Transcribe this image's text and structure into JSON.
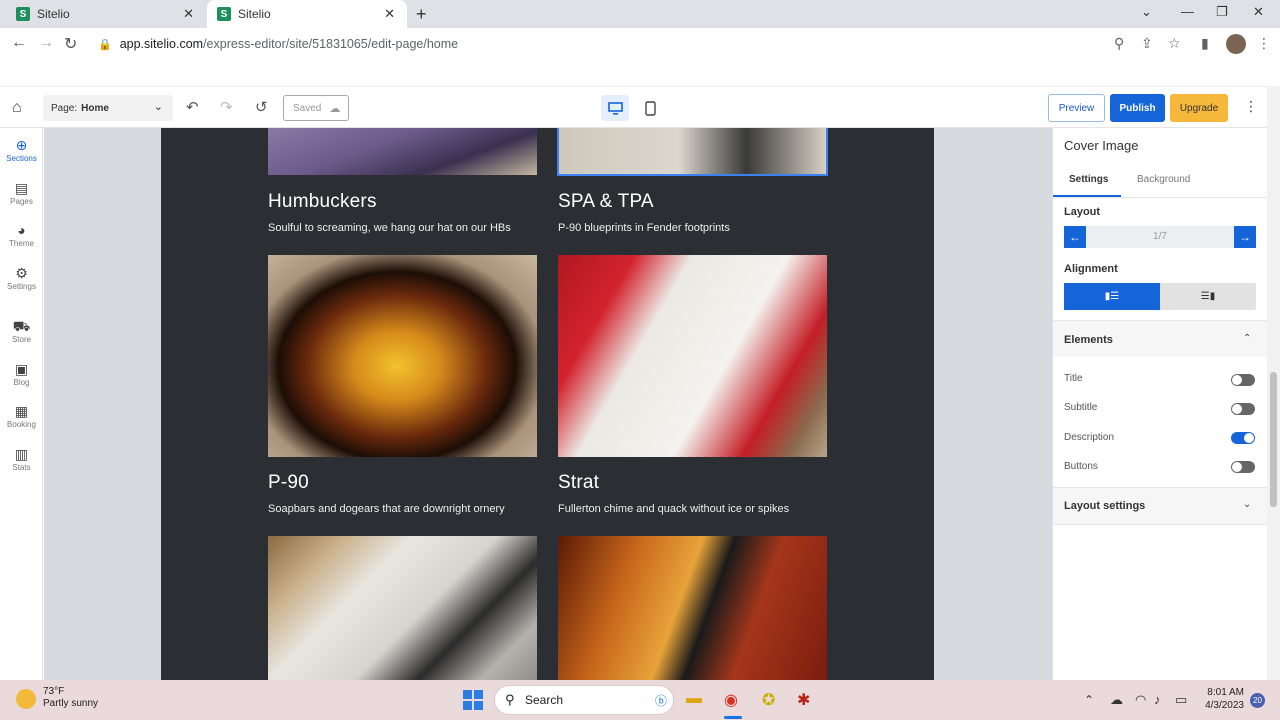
{
  "browser": {
    "tabs": [
      {
        "label": "Sitelio"
      },
      {
        "label": "Sitelio"
      }
    ],
    "url_host": "app.sitelio.com",
    "url_path": "/express-editor/site/51831065/edit-page/home"
  },
  "editor": {
    "page_label": "Page:",
    "page_value": "Home",
    "saved_label": "Saved",
    "preview_label": "Preview",
    "publish_label": "Publish",
    "upgrade_label": "Upgrade"
  },
  "rail": [
    {
      "label": "Sections",
      "icon": "plus-circle-icon"
    },
    {
      "label": "Pages",
      "icon": "page-icon"
    },
    {
      "label": "Theme",
      "icon": "palette-icon"
    },
    {
      "label": "Settings",
      "icon": "gear-icon"
    },
    {
      "label": "Store",
      "icon": "cart-icon"
    },
    {
      "label": "Blog",
      "icon": "book-icon"
    },
    {
      "label": "Booking",
      "icon": "calendar-icon"
    },
    {
      "label": "Stats",
      "icon": "chart-icon"
    }
  ],
  "cards": [
    {
      "title": "Humbuckers",
      "desc": "Soulful to screaming, we hang our hat on our HBs"
    },
    {
      "title": "SPA & TPA",
      "desc": "P-90 blueprints in Fender footprints"
    },
    {
      "title": "P-90",
      "desc": "Soapbars and dogears that are downright ornery"
    },
    {
      "title": "Strat",
      "desc": "Fullerton chime and quack without ice or spikes"
    }
  ],
  "panel": {
    "title": "Cover Image",
    "tabs": [
      "Settings",
      "Background"
    ],
    "layout_label": "Layout",
    "layout_value": "1/7",
    "alignment_label": "Alignment",
    "elements_label": "Elements",
    "toggles": [
      {
        "label": "Title",
        "on": false
      },
      {
        "label": "Subtitle",
        "on": false
      },
      {
        "label": "Description",
        "on": true
      },
      {
        "label": "Buttons",
        "on": false
      }
    ],
    "layout_settings_label": "Layout settings"
  },
  "taskbar": {
    "temp": "73°F",
    "weather": "Partly sunny",
    "search": "Search",
    "time": "8:01 AM",
    "date": "4/3/2023",
    "notif_count": "20"
  },
  "colors": {
    "accent": "#1565d8",
    "upgrade": "#f5b83a",
    "site_bg": "#2b2f33"
  }
}
